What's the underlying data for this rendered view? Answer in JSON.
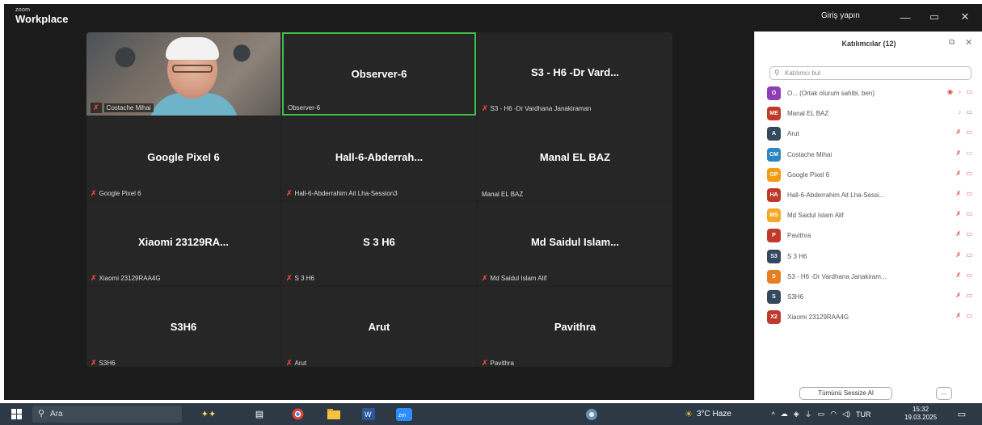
{
  "app": {
    "brand_small": "zoom",
    "brand_large": "Workplace",
    "sign_in": "Giriş yapın"
  },
  "tiles": [
    {
      "name": "",
      "label": "Costache Mihai",
      "mic_off": true,
      "video": true
    },
    {
      "name": "Observer-6",
      "label": "Observer-6",
      "mic_off": false,
      "active": true
    },
    {
      "name": "S3 - H6 -Dr Vard...",
      "label": "S3 - H6 -Dr Vardhana Janakiraman",
      "mic_off": true
    },
    {
      "name": "Google Pixel 6",
      "label": "Google Pixel 6",
      "mic_off": true
    },
    {
      "name": "Hall-6-Abderrah...",
      "label": "Hall-6-Abderrahim Ait Lha-Session3",
      "mic_off": true
    },
    {
      "name": "Manal EL BAZ",
      "label": "Manal EL BAZ",
      "mic_off": false
    },
    {
      "name": "Xiaomi 23129RA...",
      "label": "Xiaomi 23129RAA4G",
      "mic_off": true
    },
    {
      "name": "S 3 H6",
      "label": "S 3 H6",
      "mic_off": true
    },
    {
      "name": "Md Saidul Islam...",
      "label": "Md Saidul Islam Alif",
      "mic_off": true
    },
    {
      "name": "S3H6",
      "label": "S3H6",
      "mic_off": true
    },
    {
      "name": "Arut",
      "label": "Arut",
      "mic_off": true
    },
    {
      "name": "Pavithra",
      "label": "Pavithra",
      "mic_off": true
    }
  ],
  "panel": {
    "title": "Katılımcılar (12)",
    "search_placeholder": "Katılımcı bul",
    "participants": [
      {
        "initials": "O",
        "color": "#8e3fb3",
        "name": "O... (Ortak oturum sahibi, ben)",
        "status": "host"
      },
      {
        "initials": "ME",
        "color": "#c0392b",
        "name": "Manal EL BAZ",
        "status": "mic-on"
      },
      {
        "initials": "A",
        "color": "#34495e",
        "name": "Arut",
        "status": "muted"
      },
      {
        "initials": "CM",
        "color": "#2e86c1",
        "name": "Costache Mihai",
        "status": "muted-video"
      },
      {
        "initials": "GP",
        "color": "#f39c12",
        "name": "Google Pixel 6",
        "status": "muted"
      },
      {
        "initials": "HA",
        "color": "#c0392b",
        "name": "Hall-6-Abderrahim Ait Lha-Sessi...",
        "status": "muted"
      },
      {
        "initials": "MS",
        "color": "#f5a623",
        "name": "Md Saidul Islam Alif",
        "status": "muted"
      },
      {
        "initials": "P",
        "color": "#c0392b",
        "name": "Pavithra",
        "status": "muted"
      },
      {
        "initials": "S3",
        "color": "#34495e",
        "name": "S 3 H6",
        "status": "muted"
      },
      {
        "initials": "S",
        "color": "#e67e22",
        "name": "S3 - H6 -Dr Vardhana Janakiram...",
        "status": "muted"
      },
      {
        "initials": "S",
        "color": "#34495e",
        "name": "S3H6",
        "status": "muted"
      },
      {
        "initials": "X2",
        "color": "#c0392b",
        "name": "Xiaomi 23129RAA4G",
        "status": "muted"
      }
    ],
    "mute_all": "Tümünü Sessize Al",
    "more": "..."
  },
  "taskbar": {
    "search": "Ara",
    "weather": "3°C Haze",
    "lang": "TUR",
    "time": "15:32",
    "date": "19.03.2025"
  }
}
